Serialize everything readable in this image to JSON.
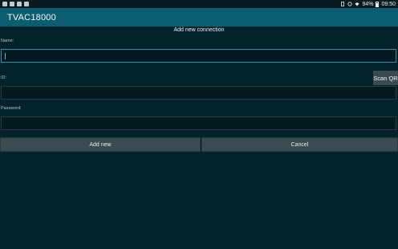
{
  "status_bar": {
    "battery": "94%",
    "time": "09:50"
  },
  "app_bar": {
    "title": "TVAC18000"
  },
  "dialog": {
    "title": "Add new connection",
    "name_label": "Name:",
    "name_value": "",
    "id_label": "ID:",
    "id_value": "",
    "scan_qr_label": "Scan QR",
    "password_label": "Password:",
    "password_value": "",
    "add_new_label": "Add new",
    "cancel_label": "Cancel"
  },
  "colors": {
    "background": "#04222c",
    "app_bar": "#0d5d70",
    "focus_border": "#2d8fb0",
    "button": "#3a4b51"
  }
}
